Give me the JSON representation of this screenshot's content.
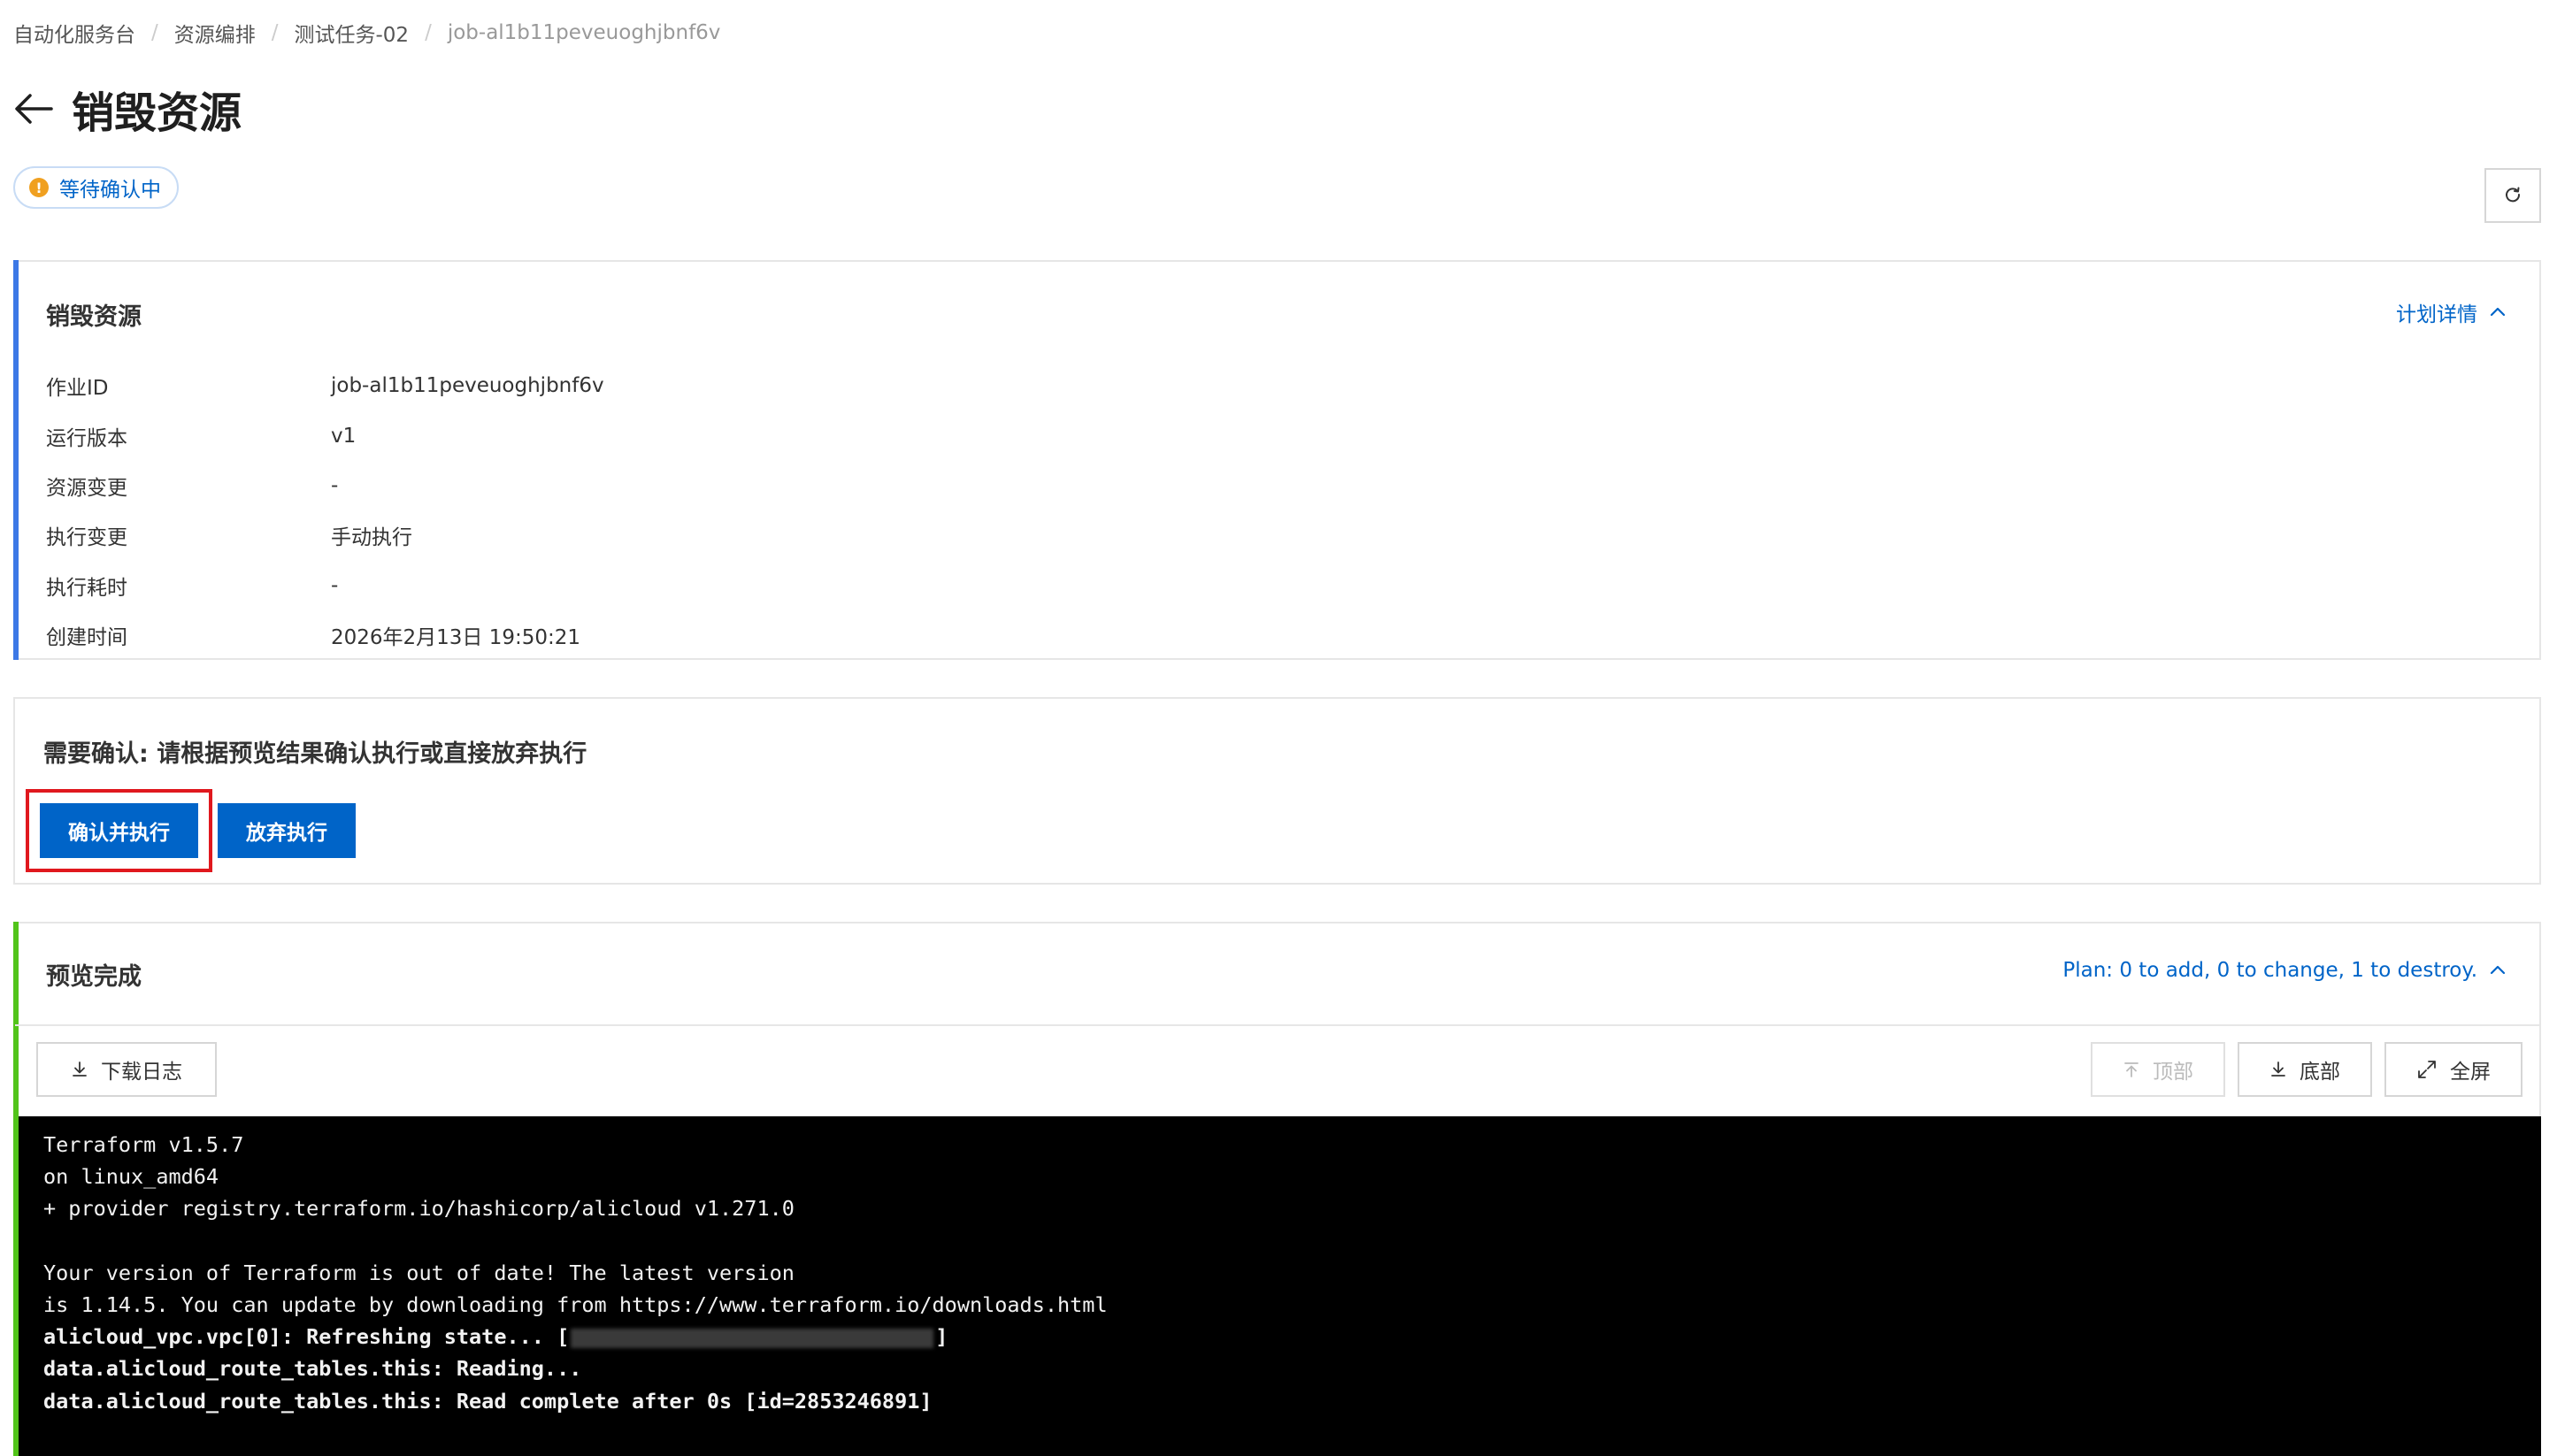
{
  "breadcrumb": {
    "items": [
      "自动化服务台",
      "资源编排",
      "测试任务-02",
      "job-al1b11peveuoghjbnf6v"
    ],
    "separator": "/"
  },
  "header": {
    "title": "销毁资源"
  },
  "status": {
    "label": "等待确认中",
    "icon_text": "!",
    "icon": "warning-icon",
    "color": "#f0a020"
  },
  "resource_card": {
    "title": "销毁资源",
    "plan_link": "计划详情",
    "accent": "#3c78e6",
    "rows": [
      {
        "key": "作业ID",
        "value": "job-al1b11peveuoghjbnf6v"
      },
      {
        "key": "运行版本",
        "value": "v1"
      },
      {
        "key": "资源变更",
        "value": "-"
      },
      {
        "key": "执行变更",
        "value": "手动执行"
      },
      {
        "key": "执行耗时",
        "value": "-"
      },
      {
        "key": "创建时间",
        "value": "2026年2月13日 19:50:21"
      }
    ]
  },
  "confirm_card": {
    "text": "需要确认: 请根据预览结果确认执行或直接放弃执行",
    "confirm_label": "确认并执行",
    "abandon_label": "放弃执行",
    "primary_color": "#0064c8"
  },
  "preview_card": {
    "title": "预览完成",
    "summary": "Plan: 0 to add, 0 to change, 1 to destroy.",
    "accent": "#52c41a",
    "buttons": {
      "download": "下载日志",
      "top": "顶部",
      "bottom": "底部",
      "fullscreen": "全屏"
    },
    "terminal": {
      "lines": [
        {
          "text": "Terraform v1.5.7",
          "bold": false
        },
        {
          "text": "on linux_amd64",
          "bold": false
        },
        {
          "text": "+ provider registry.terraform.io/hashicorp/alicloud v1.271.0",
          "bold": false
        },
        {
          "text": "",
          "bold": false
        },
        {
          "text": "Your version of Terraform is out of date! The latest version",
          "bold": false
        },
        {
          "text": "is 1.14.5. You can update by downloading from https://www.terraform.io/downloads.html",
          "bold": false
        },
        {
          "text": "alicloud_vpc.vpc[0]: Refreshing state... [",
          "bold": true,
          "redacted_suffix": "]"
        },
        {
          "text": "data.alicloud_route_tables.this: Reading...",
          "bold": true
        },
        {
          "text": "data.alicloud_route_tables.this: Read complete after 0s [id=2853246891]",
          "bold": true
        }
      ]
    }
  }
}
